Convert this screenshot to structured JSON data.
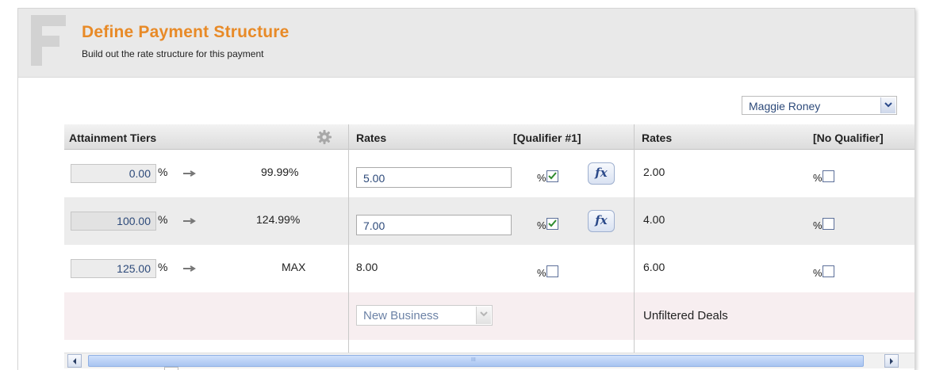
{
  "header": {
    "title": "Define Payment Structure",
    "subtitle": "Build out the rate structure for this payment"
  },
  "user_select": {
    "value": "Maggie Roney"
  },
  "columns": {
    "tiers": "Attainment Tiers",
    "rates_1": "Rates",
    "qualifier_1": "[Qualifier #1]",
    "rates_2": "Rates",
    "qualifier_2": "[No Qualifier]"
  },
  "rows": [
    {
      "tier_start": "0.00",
      "pct": "%",
      "tier_end": "99.99%",
      "rate_1": "5.00",
      "rate_1_editable": true,
      "rate_1_checked": true,
      "rate_2": "2.00",
      "rate_2_checked": false
    },
    {
      "tier_start": "100.00",
      "pct": "%",
      "tier_end": "124.99%",
      "rate_1": "7.00",
      "rate_1_editable": true,
      "rate_1_checked": true,
      "rate_2": "4.00",
      "rate_2_checked": false
    },
    {
      "tier_start": "125.00",
      "pct": "%",
      "tier_end": "MAX",
      "rate_1": "8.00",
      "rate_1_editable": false,
      "rate_1_checked": false,
      "rate_2": "6.00",
      "rate_2_checked": false
    }
  ],
  "percent_symbol": "%",
  "fx_label": "fx",
  "footer": {
    "filter_select": "New Business",
    "filter_text": "Unfiltered Deals"
  },
  "scrollbar_grip": "III",
  "colors": {
    "title_orange": "#e88a27",
    "link_blue": "#2d4a7a",
    "check_green": "#2e8b2e",
    "scroll_thumb": "#a9c5f1"
  },
  "icons": [
    "f-logo-icon",
    "gear-icon",
    "arrow-right-icon",
    "checkbox-icon",
    "chevron-down-icon",
    "chevron-left-icon",
    "chevron-right-icon"
  ]
}
